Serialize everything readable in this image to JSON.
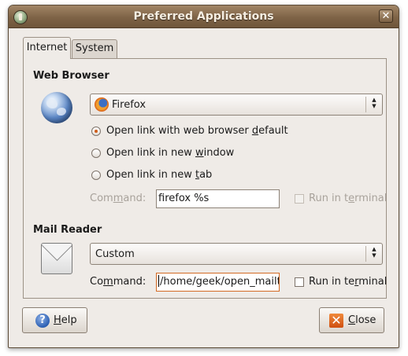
{
  "window": {
    "title": "Preferred Applications",
    "close_glyph": "✕"
  },
  "tabs": [
    {
      "label": "Internet",
      "selected": true
    },
    {
      "label": "System",
      "selected": false
    }
  ],
  "web_browser": {
    "section_title": "Web Browser",
    "selected_browser": "Firefox",
    "options": [
      {
        "before": "Open link with web browser ",
        "mnemonic": "d",
        "after": "efault",
        "selected": true
      },
      {
        "before": "Open link in new ",
        "mnemonic": "w",
        "after": "indow",
        "selected": false
      },
      {
        "before": "Open link in new ",
        "mnemonic": "t",
        "after": "ab",
        "selected": false
      }
    ],
    "command_label": {
      "before": "Com",
      "mnemonic": "m",
      "after": "and:"
    },
    "command_value": "firefox %s",
    "run_in_terminal": {
      "before": "Run in t",
      "mnemonic": "e",
      "after": "rminal",
      "checked": false,
      "enabled": false
    }
  },
  "mail_reader": {
    "section_title": "Mail Reader",
    "selected_reader": "Custom",
    "command_label": {
      "before": "Co",
      "mnemonic": "m",
      "after": "mand:"
    },
    "command_value": "/home/geek/open_mailt",
    "run_in_terminal": {
      "before": "Run in te",
      "mnemonic": "r",
      "after": "minal",
      "checked": false,
      "enabled": true
    }
  },
  "buttons": {
    "help": {
      "mnemonic": "H",
      "after": "elp"
    },
    "close": {
      "mnemonic": "C",
      "after": "lose"
    }
  },
  "icons": {
    "help_glyph": "?",
    "close_glyph": "✕",
    "spin_up": "▲",
    "spin_down": "▼"
  },
  "colors": {
    "titlebar": "#7e6346",
    "window_bg": "#efebe7",
    "focus_accent": "#d36a24",
    "radio_dot": "#cf5d1a"
  }
}
